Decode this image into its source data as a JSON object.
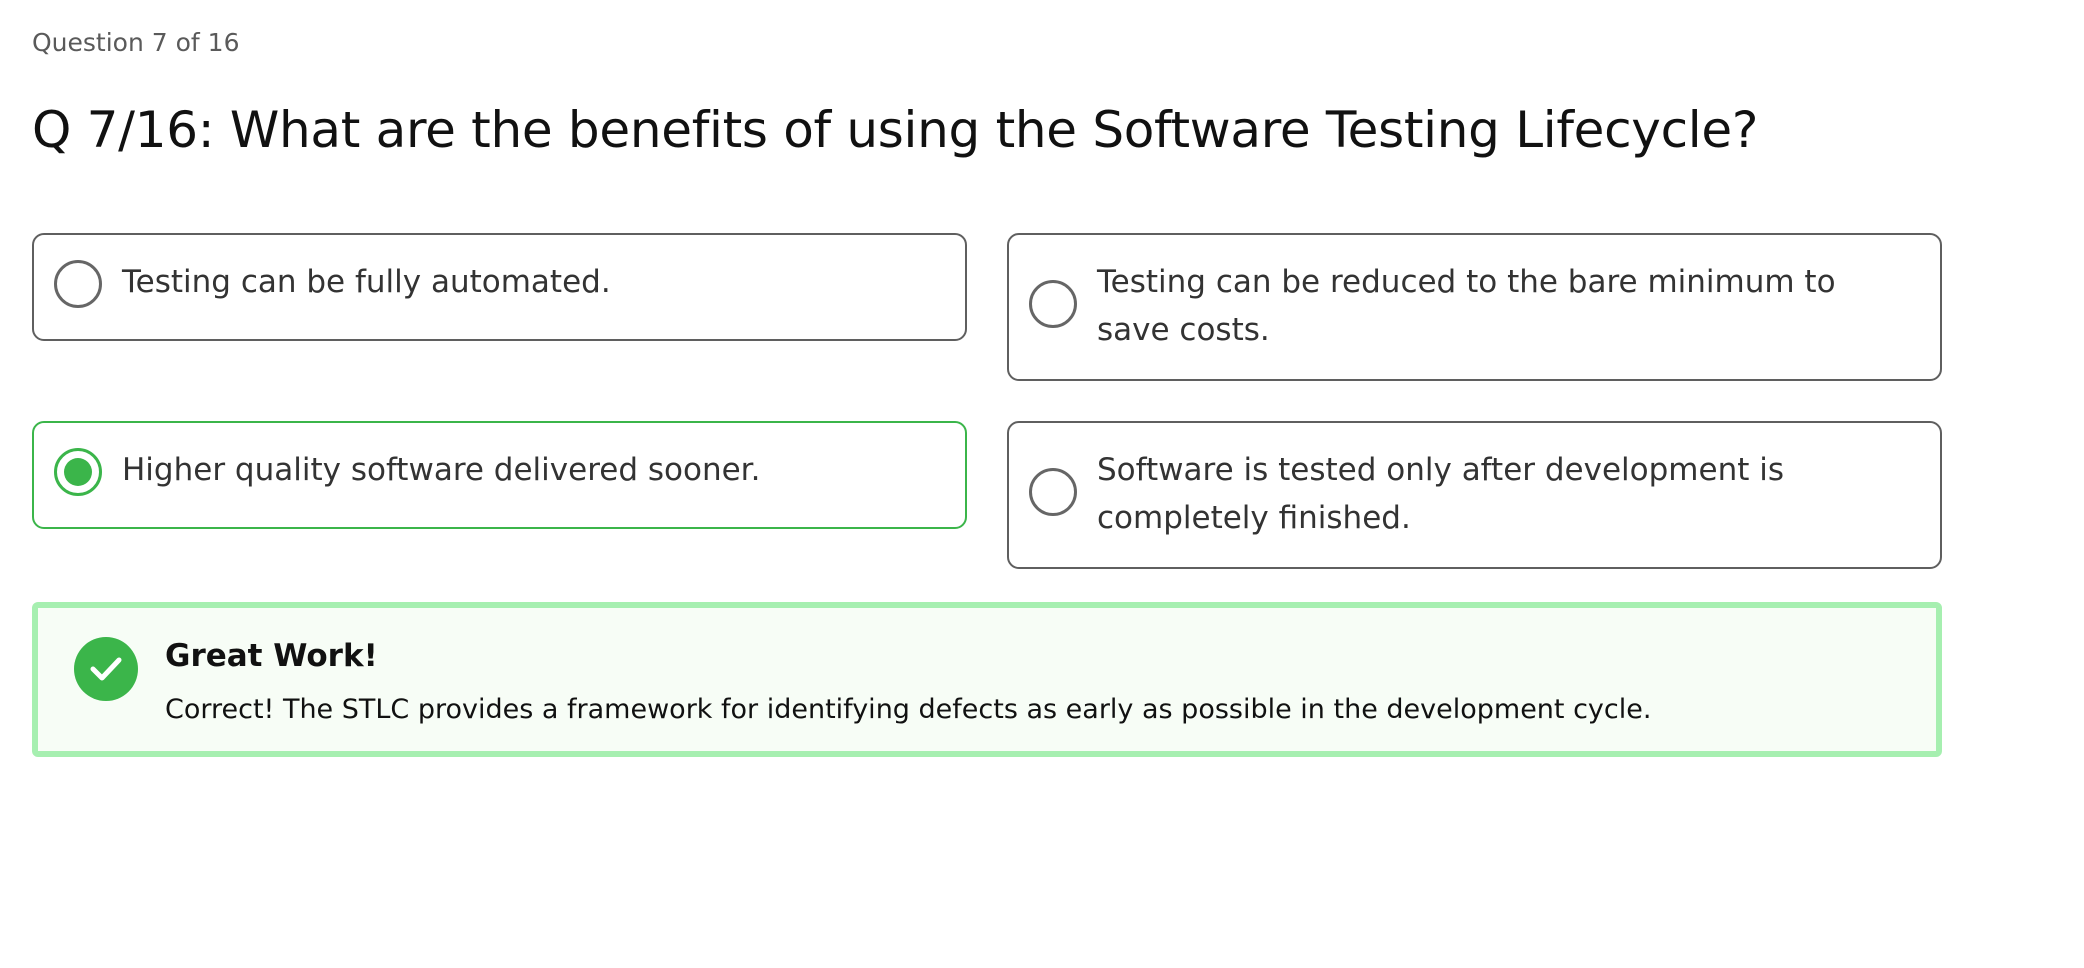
{
  "quiz": {
    "progress_label": "Question 7 of 16",
    "question": "Q 7/16: What are the benefits of using the Software Testing Lifecycle?",
    "options": [
      {
        "label": "Testing can be fully automated.",
        "selected": false
      },
      {
        "label": "Testing can be reduced to the bare minimum to save costs.",
        "selected": false
      },
      {
        "label": "Higher quality software delivered sooner.",
        "selected": true
      },
      {
        "label": "Software is tested only after development is completely finished.",
        "selected": false
      }
    ]
  },
  "feedback": {
    "title": "Great Work!",
    "message": "Correct! The STLC provides a framework for identifying defects as early as possible in the development cycle.",
    "icon": "check-icon"
  },
  "colors": {
    "accent_green": "#3bb54a",
    "feedback_border": "#a6efb0",
    "feedback_bg": "#f7fdf6",
    "option_border": "#5f5f5f"
  }
}
